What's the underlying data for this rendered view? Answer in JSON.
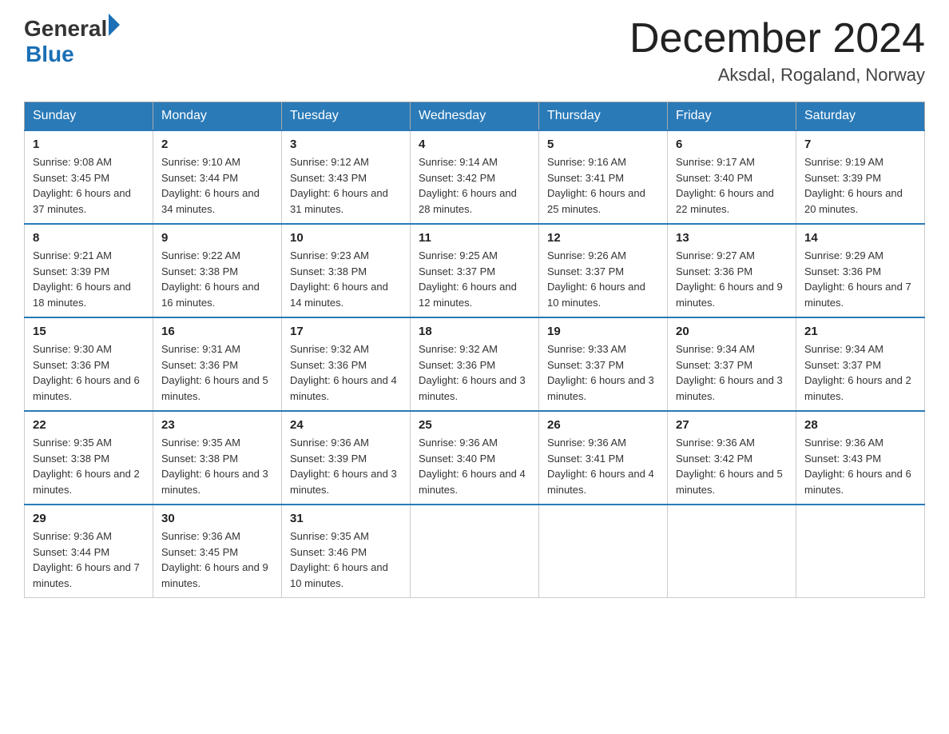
{
  "logo": {
    "general": "General",
    "blue": "Blue",
    "arrow": "▶"
  },
  "title": "December 2024",
  "location": "Aksdal, Rogaland, Norway",
  "days_of_week": [
    "Sunday",
    "Monday",
    "Tuesday",
    "Wednesday",
    "Thursday",
    "Friday",
    "Saturday"
  ],
  "weeks": [
    [
      {
        "day": "1",
        "sunrise": "9:08 AM",
        "sunset": "3:45 PM",
        "daylight": "6 hours and 37 minutes."
      },
      {
        "day": "2",
        "sunrise": "9:10 AM",
        "sunset": "3:44 PM",
        "daylight": "6 hours and 34 minutes."
      },
      {
        "day": "3",
        "sunrise": "9:12 AM",
        "sunset": "3:43 PM",
        "daylight": "6 hours and 31 minutes."
      },
      {
        "day": "4",
        "sunrise": "9:14 AM",
        "sunset": "3:42 PM",
        "daylight": "6 hours and 28 minutes."
      },
      {
        "day": "5",
        "sunrise": "9:16 AM",
        "sunset": "3:41 PM",
        "daylight": "6 hours and 25 minutes."
      },
      {
        "day": "6",
        "sunrise": "9:17 AM",
        "sunset": "3:40 PM",
        "daylight": "6 hours and 22 minutes."
      },
      {
        "day": "7",
        "sunrise": "9:19 AM",
        "sunset": "3:39 PM",
        "daylight": "6 hours and 20 minutes."
      }
    ],
    [
      {
        "day": "8",
        "sunrise": "9:21 AM",
        "sunset": "3:39 PM",
        "daylight": "6 hours and 18 minutes."
      },
      {
        "day": "9",
        "sunrise": "9:22 AM",
        "sunset": "3:38 PM",
        "daylight": "6 hours and 16 minutes."
      },
      {
        "day": "10",
        "sunrise": "9:23 AM",
        "sunset": "3:38 PM",
        "daylight": "6 hours and 14 minutes."
      },
      {
        "day": "11",
        "sunrise": "9:25 AM",
        "sunset": "3:37 PM",
        "daylight": "6 hours and 12 minutes."
      },
      {
        "day": "12",
        "sunrise": "9:26 AM",
        "sunset": "3:37 PM",
        "daylight": "6 hours and 10 minutes."
      },
      {
        "day": "13",
        "sunrise": "9:27 AM",
        "sunset": "3:36 PM",
        "daylight": "6 hours and 9 minutes."
      },
      {
        "day": "14",
        "sunrise": "9:29 AM",
        "sunset": "3:36 PM",
        "daylight": "6 hours and 7 minutes."
      }
    ],
    [
      {
        "day": "15",
        "sunrise": "9:30 AM",
        "sunset": "3:36 PM",
        "daylight": "6 hours and 6 minutes."
      },
      {
        "day": "16",
        "sunrise": "9:31 AM",
        "sunset": "3:36 PM",
        "daylight": "6 hours and 5 minutes."
      },
      {
        "day": "17",
        "sunrise": "9:32 AM",
        "sunset": "3:36 PM",
        "daylight": "6 hours and 4 minutes."
      },
      {
        "day": "18",
        "sunrise": "9:32 AM",
        "sunset": "3:36 PM",
        "daylight": "6 hours and 3 minutes."
      },
      {
        "day": "19",
        "sunrise": "9:33 AM",
        "sunset": "3:37 PM",
        "daylight": "6 hours and 3 minutes."
      },
      {
        "day": "20",
        "sunrise": "9:34 AM",
        "sunset": "3:37 PM",
        "daylight": "6 hours and 3 minutes."
      },
      {
        "day": "21",
        "sunrise": "9:34 AM",
        "sunset": "3:37 PM",
        "daylight": "6 hours and 2 minutes."
      }
    ],
    [
      {
        "day": "22",
        "sunrise": "9:35 AM",
        "sunset": "3:38 PM",
        "daylight": "6 hours and 2 minutes."
      },
      {
        "day": "23",
        "sunrise": "9:35 AM",
        "sunset": "3:38 PM",
        "daylight": "6 hours and 3 minutes."
      },
      {
        "day": "24",
        "sunrise": "9:36 AM",
        "sunset": "3:39 PM",
        "daylight": "6 hours and 3 minutes."
      },
      {
        "day": "25",
        "sunrise": "9:36 AM",
        "sunset": "3:40 PM",
        "daylight": "6 hours and 4 minutes."
      },
      {
        "day": "26",
        "sunrise": "9:36 AM",
        "sunset": "3:41 PM",
        "daylight": "6 hours and 4 minutes."
      },
      {
        "day": "27",
        "sunrise": "9:36 AM",
        "sunset": "3:42 PM",
        "daylight": "6 hours and 5 minutes."
      },
      {
        "day": "28",
        "sunrise": "9:36 AM",
        "sunset": "3:43 PM",
        "daylight": "6 hours and 6 minutes."
      }
    ],
    [
      {
        "day": "29",
        "sunrise": "9:36 AM",
        "sunset": "3:44 PM",
        "daylight": "6 hours and 7 minutes."
      },
      {
        "day": "30",
        "sunrise": "9:36 AM",
        "sunset": "3:45 PM",
        "daylight": "6 hours and 9 minutes."
      },
      {
        "day": "31",
        "sunrise": "9:35 AM",
        "sunset": "3:46 PM",
        "daylight": "6 hours and 10 minutes."
      },
      null,
      null,
      null,
      null
    ]
  ],
  "labels": {
    "sunrise": "Sunrise:",
    "sunset": "Sunset:",
    "daylight": "Daylight:"
  }
}
